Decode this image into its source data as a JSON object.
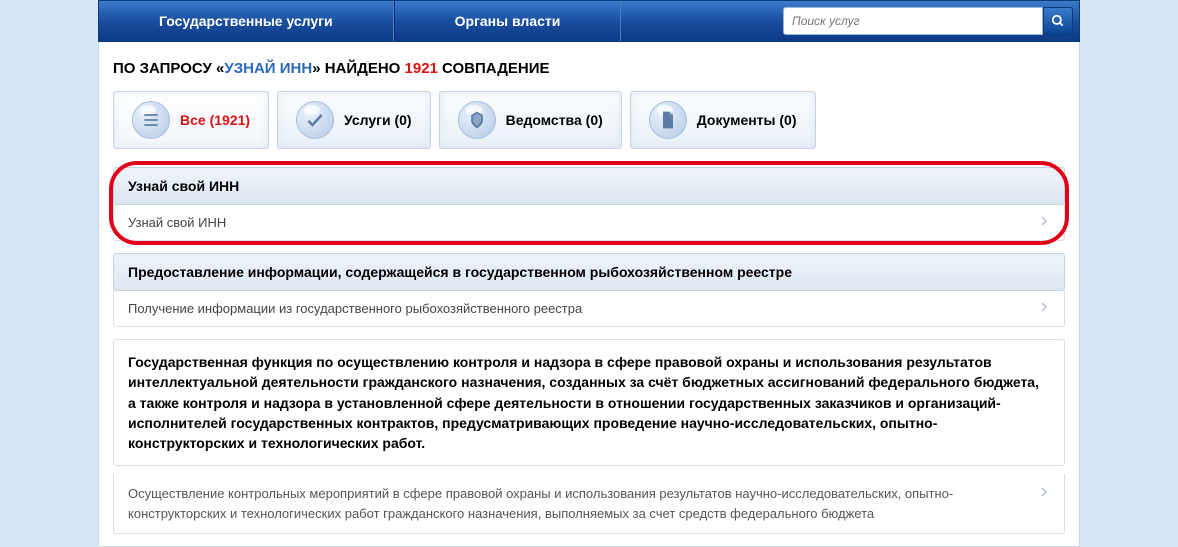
{
  "nav": {
    "services": "Государственные услуги",
    "authorities": "Органы власти"
  },
  "search": {
    "placeholder": "Поиск услуг"
  },
  "query": {
    "prefix": "ПО ЗАПРОСУ «",
    "text": "УЗНАЙ ИНН",
    "mid": "» НАЙДЕНО ",
    "count": "1921",
    "suffix": " СОВПАДЕНИЕ"
  },
  "tabs": {
    "all": "Все (1921)",
    "services": "Услуги (0)",
    "agencies": "Ведомства (0)",
    "docs": "Документы (0)"
  },
  "results": {
    "r1": {
      "title": "Узнай свой ИНН",
      "item": "Узнай свой ИНН"
    },
    "r2": {
      "title": "Предоставление информации, содержащейся в государственном рыбохозяйственном реестре",
      "item": "Получение информации из государственного рыбохозяйственного реестра"
    },
    "r3": {
      "title": "Государственная функция по осуществлению контроля и надзора в сфере правовой охраны и использования результатов интеллектуальной деятельности гражданского назначения, созданных за счёт бюджетных ассигнований федерального бюджета, а также контроля и надзора в установленной сфере деятельности в отношении государственных заказчиков и организаций-исполнителей государственных контрактов, предусматривающих проведение научно-исследовательских, опытно-конструкторских и технологических работ.",
      "item": "Осуществление контрольных мероприятий в сфере правовой охраны и использования результатов научно-исследовательских, опытно-конструкторских и технологических работ гражданского назначения, выполняемых за счет средств федерального бюджета"
    }
  }
}
